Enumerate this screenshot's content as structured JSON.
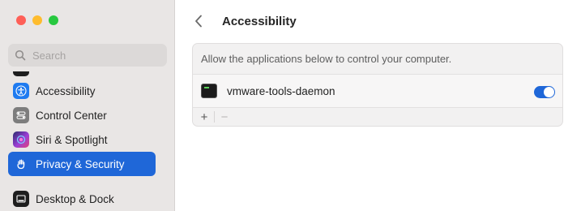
{
  "sidebar": {
    "search": {
      "placeholder": "Search",
      "value": ""
    },
    "items": [
      {
        "label": "Accessibility",
        "icon": "accessibility-icon",
        "color": "#1f7bf0",
        "active": false
      },
      {
        "label": "Control Center",
        "icon": "control-center-icon",
        "color": "#7d7d7d",
        "active": false
      },
      {
        "label": "Siri & Spotlight",
        "icon": "siri-icon",
        "color": "#7a3fd6",
        "active": false
      },
      {
        "label": "Privacy & Security",
        "icon": "hand-icon",
        "color": "#1f67d8",
        "active": true
      },
      {
        "label": "Desktop & Dock",
        "icon": "dock-icon",
        "color": "#1e1e1e",
        "active": false
      }
    ]
  },
  "header": {
    "title": "Accessibility"
  },
  "panel": {
    "description": "Allow the applications below to control your computer.",
    "apps": [
      {
        "name": "vmware-tools-daemon",
        "enabled": true
      }
    ],
    "add_label": "+",
    "remove_label": "−"
  },
  "colors": {
    "accent": "#1f67d8",
    "sidebar_bg": "#e9e6e5"
  }
}
